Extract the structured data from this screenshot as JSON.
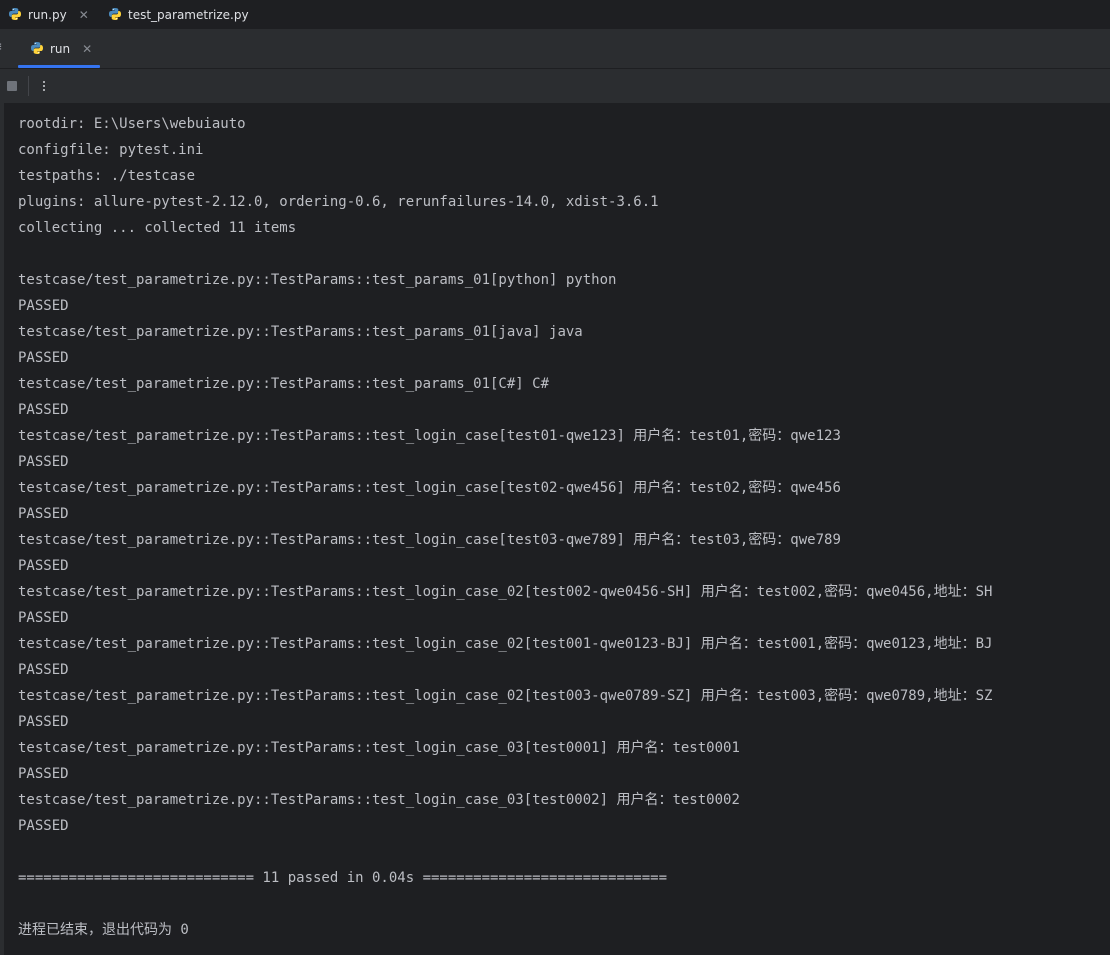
{
  "editor_tabs": [
    {
      "label": "run.py",
      "icon": "python-icon",
      "closable": true
    },
    {
      "label": "test_parametrize.py",
      "icon": "python-icon",
      "closable": false
    }
  ],
  "run_panel": {
    "tab_label": "run",
    "tab_icon": "python-icon",
    "accent": "#3574f0"
  },
  "toolbar": {
    "stop_icon": "stop-icon",
    "more_icon": "more-vertical-icon"
  },
  "console": {
    "lines": [
      "rootdir: E:\\Users\\webuiauto",
      "configfile: pytest.ini",
      "testpaths: ./testcase",
      "plugins: allure-pytest-2.12.0, ordering-0.6, rerunfailures-14.0, xdist-3.6.1",
      "collecting ... collected 11 items",
      "",
      "testcase/test_parametrize.py::TestParams::test_params_01[python] python",
      "PASSED",
      "testcase/test_parametrize.py::TestParams::test_params_01[java] java",
      "PASSED",
      "testcase/test_parametrize.py::TestParams::test_params_01[C#] C#",
      "PASSED",
      "testcase/test_parametrize.py::TestParams::test_login_case[test01-qwe123] 用户名：test01,密码：qwe123",
      "PASSED",
      "testcase/test_parametrize.py::TestParams::test_login_case[test02-qwe456] 用户名：test02,密码：qwe456",
      "PASSED",
      "testcase/test_parametrize.py::TestParams::test_login_case[test03-qwe789] 用户名：test03,密码：qwe789",
      "PASSED",
      "testcase/test_parametrize.py::TestParams::test_login_case_02[test002-qwe0456-SH] 用户名：test002,密码：qwe0456,地址：SH",
      "PASSED",
      "testcase/test_parametrize.py::TestParams::test_login_case_02[test001-qwe0123-BJ] 用户名：test001,密码：qwe0123,地址：BJ",
      "PASSED",
      "testcase/test_parametrize.py::TestParams::test_login_case_02[test003-qwe0789-SZ] 用户名：test003,密码：qwe0789,地址：SZ",
      "PASSED",
      "testcase/test_parametrize.py::TestParams::test_login_case_03[test0001] 用户名：test0001",
      "PASSED",
      "testcase/test_parametrize.py::TestParams::test_login_case_03[test0002] 用户名：test0002",
      "PASSED",
      "",
      "============================ 11 passed in 0.04s =============================",
      "",
      "进程已结束，退出代码为 0"
    ]
  }
}
